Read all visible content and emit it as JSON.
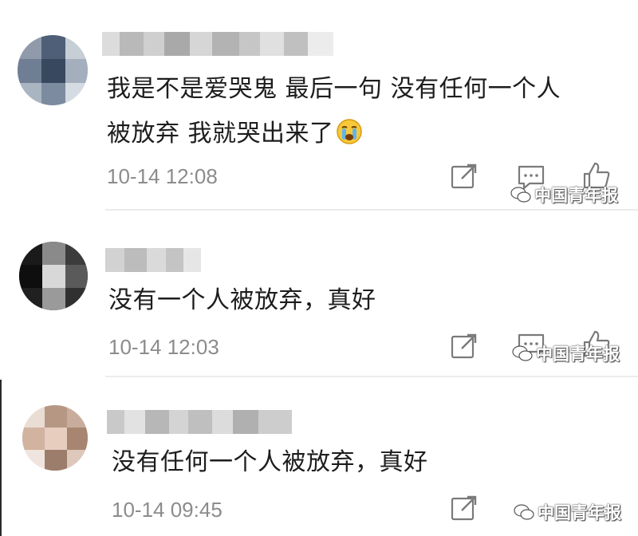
{
  "comments": [
    {
      "text_line1": "我是不是爱哭鬼 最后一句 没有任何一个人",
      "text_line2": "被放弃 我就哭出来了",
      "emoji": "crying-face",
      "time": "10-14 12:08",
      "watermark": "中国青年报"
    },
    {
      "text_line1": "没有一个人被放弃，真好",
      "time": "10-14 12:03",
      "watermark": "中国青年报"
    },
    {
      "text_line1": "没有任何一个人被放弃，真好",
      "time": "10-14 09:45",
      "watermark": "中国青年报"
    }
  ],
  "icons": {
    "share": "share-icon",
    "reply": "comment-icon",
    "like": "thumbs-up-icon",
    "wechat": "wechat-icon"
  }
}
